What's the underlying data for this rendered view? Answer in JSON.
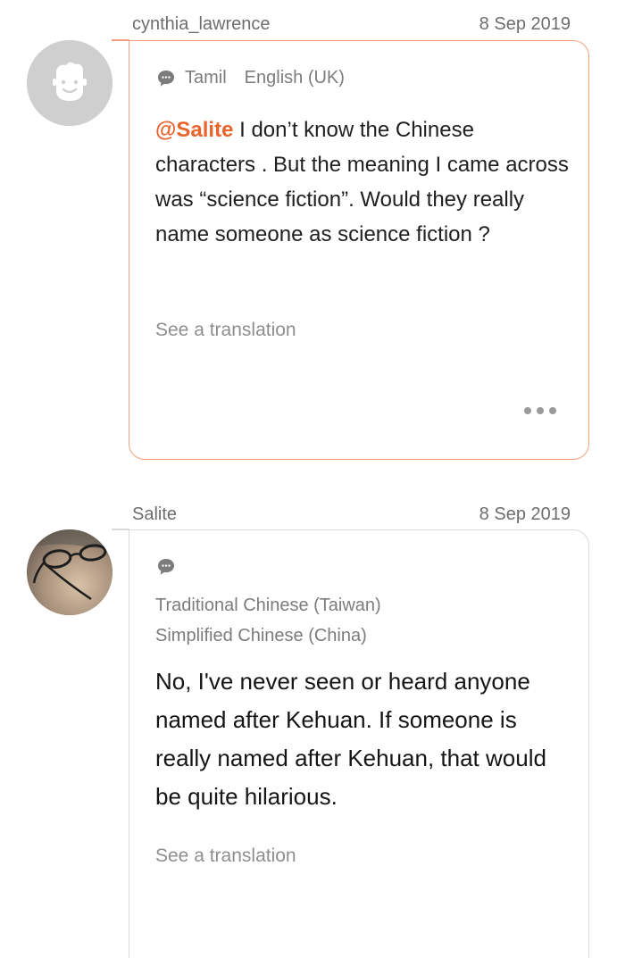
{
  "posts": [
    {
      "username": "cynthia_lawrence",
      "date": "8 Sep 2019",
      "languages": [
        "Tamil",
        "English (UK)"
      ],
      "mention": "@Salite",
      "text": " I don’t know the Chinese characters . But the meaning I came across was “science fiction”. Would they really name someone as science fiction ?",
      "see_translation": "See a translation",
      "avatar": "default-face-avatar",
      "more_icon": "more-dots-icon"
    },
    {
      "username": "Salite",
      "date": "8 Sep 2019",
      "languages": [
        "Traditional Chinese (Taiwan)",
        "Simplified Chinese (China)"
      ],
      "text": "No, I've never seen or heard anyone named after Kehuan. If someone is really named after Kehuan, that would be quite hilarious.",
      "see_translation": "See a translation",
      "avatar": "glasses-photo-avatar"
    }
  ],
  "colors": {
    "mention": "#e8642c",
    "bubble_highlight_border": "#f2a27e",
    "bubble_border": "#dadada",
    "meta_text": "#6d6d6d"
  },
  "icons": {
    "language": "chat-bubble-icon"
  }
}
